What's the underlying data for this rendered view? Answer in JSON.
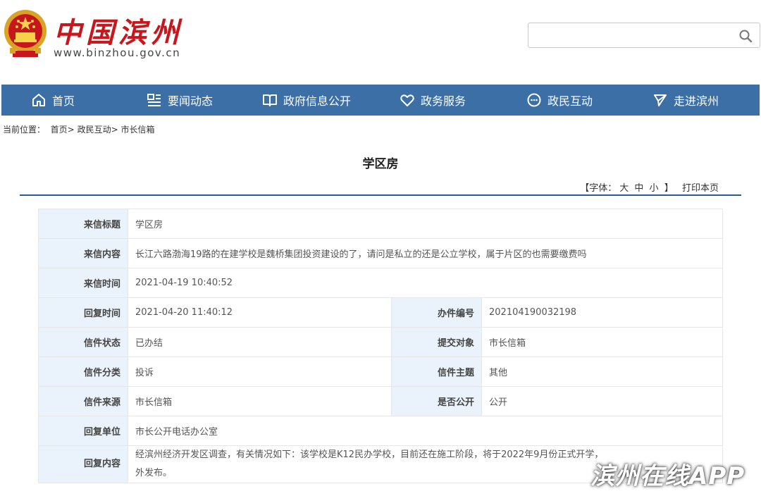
{
  "header": {
    "logo_text": "中国滨州",
    "logo_url": "www.binzhou.gov.cn",
    "search_placeholder": ""
  },
  "nav": {
    "items": [
      {
        "label": "首页",
        "icon": "home-icon"
      },
      {
        "label": "要闻动态",
        "icon": "news-icon"
      },
      {
        "label": "政府信息公开",
        "icon": "book-icon"
      },
      {
        "label": "政务服务",
        "icon": "heart-icon"
      },
      {
        "label": "政民互动",
        "icon": "chat-icon"
      },
      {
        "label": "走进滨州",
        "icon": "send-icon"
      }
    ]
  },
  "breadcrumb": {
    "prefix": "当前位置：",
    "items": [
      "首页",
      "政民互动",
      "市长信箱"
    ],
    "sep": ">"
  },
  "page_title": "学区房",
  "tools": {
    "font_label": "【字体：",
    "large": "大",
    "medium": "中",
    "small": "小",
    "close": "】",
    "print": "打印本页"
  },
  "letter": {
    "title_label": "来信标题",
    "title": "学区房",
    "content_label": "来信内容",
    "content": "长江六路渤海19路的在建学校是魏桥集团投资建设的了，请问是私立的还是公立学校，属于片区的也需要缴费吗",
    "time_label": "来信时间",
    "time": "2021-04-19 10:40:52",
    "reply_time_label": "回复时间",
    "reply_time": "2021-04-20 11:40:12",
    "number_label": "办件编号",
    "number": "202104190032198",
    "status_label": "信件状态",
    "status": "已办结",
    "target_label": "提交对象",
    "target": "市长信箱",
    "category_label": "信件分类",
    "category": "投诉",
    "topic_label": "信件主题",
    "topic": "其他",
    "source_label": "信件来源",
    "source": "市长信箱",
    "public_label": "是否公开",
    "public": "公开",
    "reply_unit_label": "回复单位",
    "reply_unit": "市长公开电话办公室",
    "reply_content_label": "回复内容",
    "reply_content_line1": "经滨州经济开发区调查，有关情况如下：该学校是K12民办学校，目前还在施工阶段，将于2022年9月份正式开学，",
    "reply_content_line2": "外发布。"
  },
  "watermark": "滨州在线APP",
  "colors": {
    "nav_bg": "#3b6fa6",
    "logo_red": "#c8161d",
    "label_bg": "#eaf3fb",
    "rule": "#2a5d8f"
  }
}
